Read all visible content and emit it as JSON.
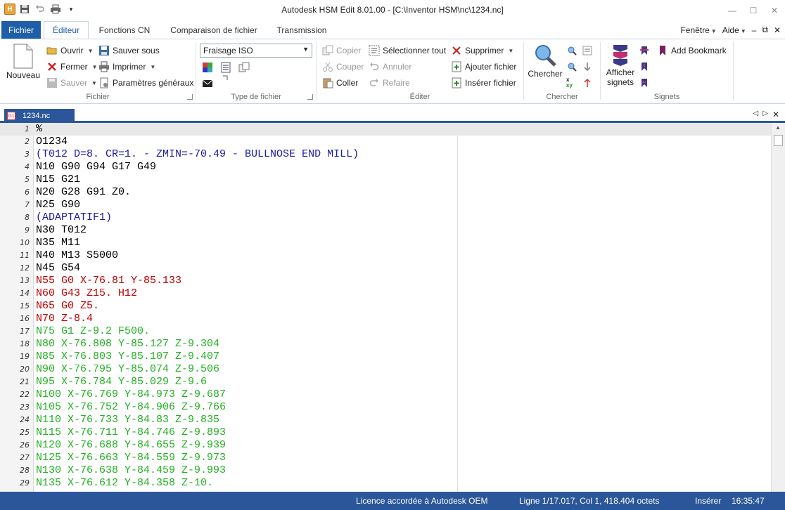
{
  "window": {
    "title": "Autodesk HSM Edit 8.01.00 - [C:\\Inventor HSM\\nc\\1234.nc]",
    "app_icon_letter": "H"
  },
  "ribbon_tabs": {
    "file": "Fichier",
    "items": [
      "Éditeur",
      "Fonctions CN",
      "Comparaison de fichier",
      "Transmission"
    ],
    "active": "Éditeur",
    "right": {
      "window_menu": "Fenêtre",
      "help_menu": "Aide"
    }
  },
  "ribbon": {
    "fichier": {
      "label": "Fichier",
      "nouveau": "Nouveau",
      "ouvrir": "Ouvrir",
      "fermer": "Fermer",
      "sauver": "Sauver",
      "sauver_sous": "Sauver sous",
      "imprimer": "Imprimer",
      "parametres": "Paramètres généraux"
    },
    "type_fichier": {
      "label": "Type de fichier",
      "selected": "Fraisage ISO"
    },
    "editer": {
      "label": "Éditer",
      "copier": "Copier",
      "couper": "Couper",
      "coller": "Coller",
      "selectionner_tout": "Sélectionner tout",
      "annuler": "Annuler",
      "refaire": "Refaire",
      "supprimer": "Supprimer",
      "ajouter_fichier": "Ajouter fichier",
      "inserer_fichier": "Insérer fichier"
    },
    "chercher": {
      "label": "Chercher",
      "chercher": "Chercher"
    },
    "signets": {
      "label": "Signets",
      "afficher": "Afficher signets",
      "add_bookmark": "Add Bookmark"
    }
  },
  "doc_tab": {
    "name": "1234.nc"
  },
  "editor": {
    "lines": [
      {
        "n": "1",
        "text": "%",
        "color": "#000000"
      },
      {
        "n": "2",
        "text": "O1234",
        "color": "#000000"
      },
      {
        "n": "3",
        "text": "(T012 D=8. CR=1. - ZMIN=-70.49 - BULLNOSE END MILL)",
        "color": "#1a1aa8"
      },
      {
        "n": "4",
        "text": "N10 G90 G94 G17 G49",
        "color": "#000000"
      },
      {
        "n": "5",
        "text": "N15 G21",
        "color": "#000000"
      },
      {
        "n": "6",
        "text": "N20 G28 G91 Z0.",
        "color": "#000000"
      },
      {
        "n": "7",
        "text": "N25 G90",
        "color": "#000000"
      },
      {
        "n": "8",
        "text": "(ADAPTATIF1)",
        "color": "#1a1aa8"
      },
      {
        "n": "9",
        "text": "N30 T012",
        "color": "#000000"
      },
      {
        "n": "10",
        "text": "N35 M11",
        "color": "#000000"
      },
      {
        "n": "11",
        "text": "N40 M13 S5000",
        "color": "#000000"
      },
      {
        "n": "12",
        "text": "N45 G54",
        "color": "#000000"
      },
      {
        "n": "13",
        "text": "N55 G0 X-76.81 Y-85.133",
        "color": "#c00000"
      },
      {
        "n": "14",
        "text": "N60 G43 Z15. H12",
        "color": "#c00000"
      },
      {
        "n": "15",
        "text": "N65 G0 Z5.",
        "color": "#c00000"
      },
      {
        "n": "16",
        "text": "N70 Z-8.4",
        "color": "#c00000"
      },
      {
        "n": "17",
        "text": "N75 G1 Z-9.2 F500.",
        "color": "#22b022"
      },
      {
        "n": "18",
        "text": "N80 X-76.808 Y-85.127 Z-9.304",
        "color": "#22b022"
      },
      {
        "n": "19",
        "text": "N85 X-76.803 Y-85.107 Z-9.407",
        "color": "#22b022"
      },
      {
        "n": "20",
        "text": "N90 X-76.795 Y-85.074 Z-9.506",
        "color": "#22b022"
      },
      {
        "n": "21",
        "text": "N95 X-76.784 Y-85.029 Z-9.6",
        "color": "#22b022"
      },
      {
        "n": "22",
        "text": "N100 X-76.769 Y-84.973 Z-9.687",
        "color": "#22b022"
      },
      {
        "n": "23",
        "text": "N105 X-76.752 Y-84.906 Z-9.766",
        "color": "#22b022"
      },
      {
        "n": "24",
        "text": "N110 X-76.733 Y-84.83 Z-9.835",
        "color": "#22b022"
      },
      {
        "n": "25",
        "text": "N115 X-76.711 Y-84.746 Z-9.893",
        "color": "#22b022"
      },
      {
        "n": "26",
        "text": "N120 X-76.688 Y-84.655 Z-9.939",
        "color": "#22b022"
      },
      {
        "n": "27",
        "text": "N125 X-76.663 Y-84.559 Z-9.973",
        "color": "#22b022"
      },
      {
        "n": "28",
        "text": "N130 X-76.638 Y-84.459 Z-9.993",
        "color": "#22b022"
      },
      {
        "n": "29",
        "text": "N135 X-76.612 Y-84.358 Z-10.",
        "color": "#22b022"
      }
    ]
  },
  "status": {
    "licence": "Licence accordée à Autodesk OEM",
    "position": "Ligne 1/17.017, Col 1, 418.404 octets",
    "mode": "Insérer",
    "time": "16:35:47"
  },
  "colors": {
    "accent": "#2b579a",
    "file_tab": "#1f5fa8",
    "comment": "#1a1aa8",
    "rapid": "#c00000",
    "feed": "#22b022"
  }
}
